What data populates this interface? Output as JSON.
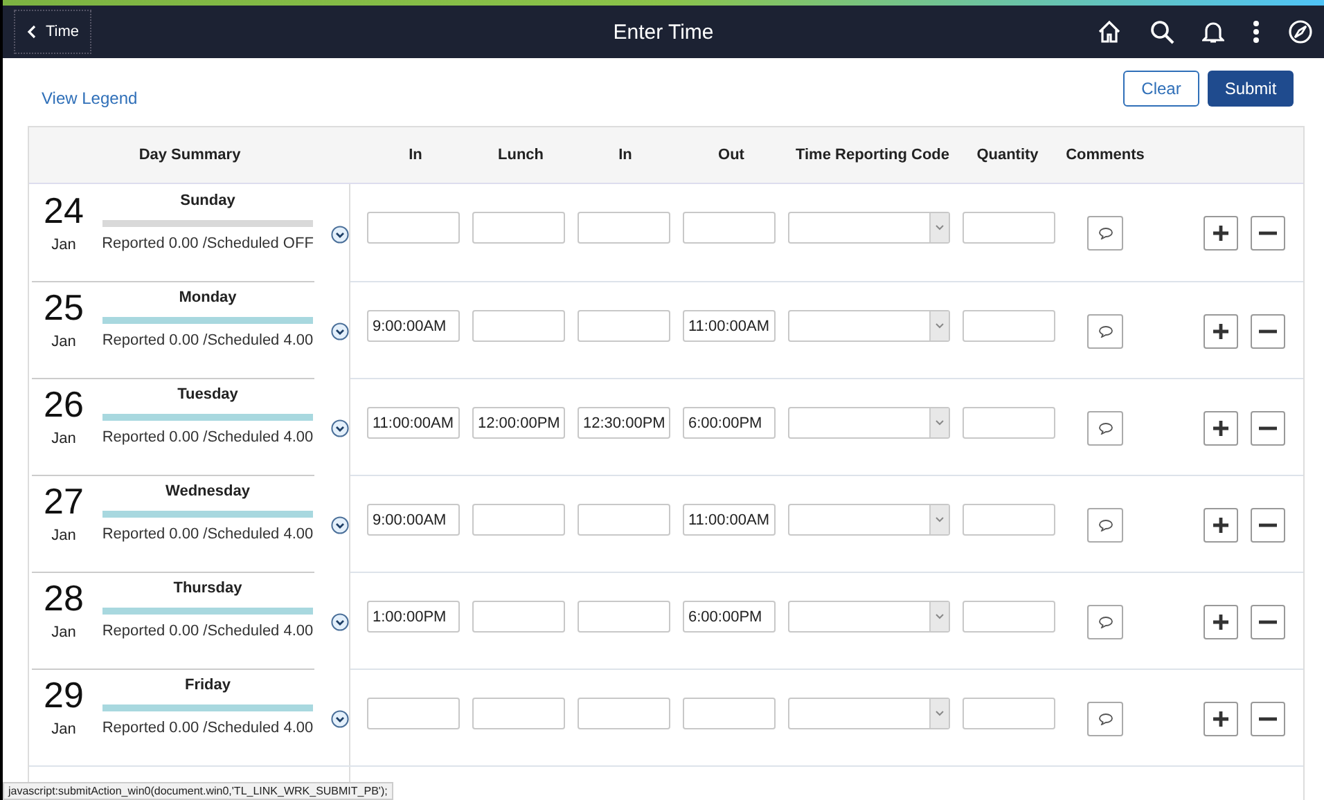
{
  "header": {
    "back": "Time",
    "title": "Enter Time"
  },
  "actions": {
    "legend": "View Legend",
    "clear": "Clear",
    "submit": "Submit"
  },
  "columns": [
    "Day Summary",
    "In",
    "Lunch",
    "In",
    "Out",
    "Time Reporting Code",
    "Quantity",
    "Comments"
  ],
  "days": [
    {
      "day": "24",
      "month": "Jan",
      "weekday": "Sunday",
      "color": "#d9d9d9",
      "summary": "Reported 0.00 /Scheduled OFF"
    },
    {
      "day": "25",
      "month": "Jan",
      "weekday": "Monday",
      "color": "#a8d8df",
      "summary": "Reported 0.00 /Scheduled 4.00",
      "in": "9:00:00AM",
      "out": "11:00:00AM"
    },
    {
      "day": "26",
      "month": "Jan",
      "weekday": "Tuesday",
      "color": "#a8d8df",
      "summary": "Reported 0.00 /Scheduled 4.00",
      "in": "11:00:00AM",
      "lunch": "12:00:00PM",
      "in_2": "12:30:00PM",
      "out": "6:00:00PM"
    },
    {
      "day": "27",
      "month": "Jan",
      "weekday": "Wednesday",
      "color": "#a8d8df",
      "summary": "Reported 0.00 /Scheduled 4.00",
      "in": "9:00:00AM",
      "out": "11:00:00AM"
    },
    {
      "day": "28",
      "month": "Jan",
      "weekday": "Thursday",
      "color": "#a8d8df",
      "summary": "Reported 0.00 /Scheduled 4.00",
      "in": "1:00:00PM",
      "out": "6:00:00PM"
    },
    {
      "day": "29",
      "month": "Jan",
      "weekday": "Friday",
      "color": "#a8d8df",
      "summary": "Reported 0.00 /Scheduled 4.00"
    }
  ],
  "status_bar": "javascript:submitAction_win0(document.win0,'TL_LINK_WRK_SUBMIT_PB');"
}
